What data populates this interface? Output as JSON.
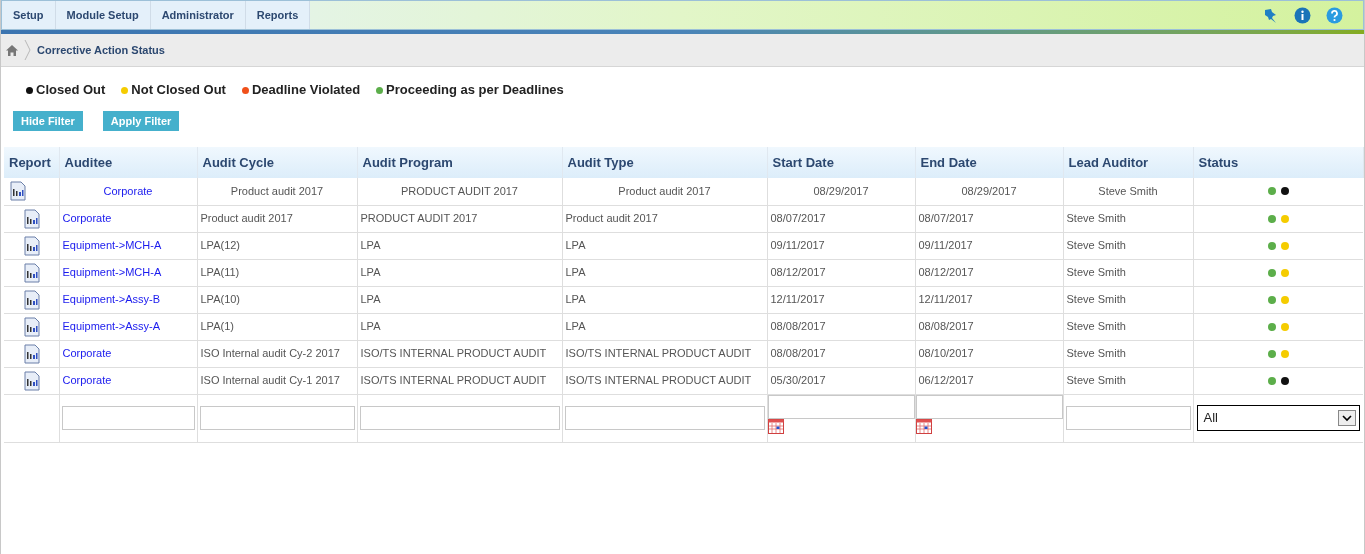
{
  "menu": [
    {
      "label": "Setup",
      "selected": false
    },
    {
      "label": "Module Setup",
      "selected": false
    },
    {
      "label": "Administrator",
      "selected": false
    },
    {
      "label": "Reports",
      "selected": false
    }
  ],
  "breadcrumb": {
    "title": "Corrective Action Status"
  },
  "legend": [
    {
      "label": "Closed Out",
      "color": "#111111"
    },
    {
      "label": "Not Closed Out",
      "color": "#f5cc00"
    },
    {
      "label": "Deadline Violated",
      "color": "#f0501a"
    },
    {
      "label": "Proceeding as per Deadlines",
      "color": "#5cae4a"
    }
  ],
  "buttons": [
    "Hide Filter",
    "Apply Filter"
  ],
  "table": {
    "columns": [
      "Report",
      "Auditee",
      "Audit Cycle",
      "Audit Program",
      "Audit Type",
      "Start Date",
      "End Date",
      "Lead Auditor",
      "Status"
    ],
    "rows": [
      {
        "kind": "centered",
        "auditee": "Corporate",
        "audit_cycle": "Product audit 2017",
        "audit_program": "PRODUCT AUDIT 2017",
        "audit_type": "Product audit 2017",
        "start_date": "08/29/2017",
        "end_date": "08/29/2017",
        "lead_auditor": "Steve Smith",
        "status": [
          {
            "color": "#5cae4a"
          },
          {
            "color": "#111111"
          }
        ]
      },
      {
        "kind": "plain",
        "auditee": "Corporate",
        "audit_cycle": "Product audit 2017",
        "audit_program": "PRODUCT AUDIT 2017",
        "audit_type": "Product audit 2017",
        "start_date": "08/07/2017",
        "end_date": "08/07/2017",
        "lead_auditor": "Steve Smith",
        "status": [
          {
            "color": "#5cae4a"
          },
          {
            "color": "#f5cc00"
          }
        ]
      },
      {
        "kind": "plain",
        "auditee": "Equipment->MCH-A",
        "audit_cycle": "LPA(12)",
        "audit_program": "LPA",
        "audit_type": "LPA",
        "start_date": "09/11/2017",
        "end_date": "09/11/2017",
        "lead_auditor": "Steve Smith",
        "status": [
          {
            "color": "#5cae4a"
          },
          {
            "color": "#f5cc00"
          }
        ]
      },
      {
        "kind": "plain",
        "auditee": "Equipment->MCH-A",
        "audit_cycle": "LPA(11)",
        "audit_program": "LPA",
        "audit_type": "LPA",
        "start_date": "08/12/2017",
        "end_date": "08/12/2017",
        "lead_auditor": "Steve Smith",
        "status": [
          {
            "color": "#5cae4a"
          },
          {
            "color": "#f5cc00"
          }
        ]
      },
      {
        "kind": "plain",
        "auditee": "Equipment->Assy-B",
        "audit_cycle": "LPA(10)",
        "audit_program": "LPA",
        "audit_type": "LPA",
        "start_date": "12/11/2017",
        "end_date": "12/11/2017",
        "lead_auditor": "Steve Smith",
        "status": [
          {
            "color": "#5cae4a"
          },
          {
            "color": "#f5cc00"
          }
        ]
      },
      {
        "kind": "plain",
        "auditee": "Equipment->Assy-A",
        "audit_cycle": "LPA(1)",
        "audit_program": "LPA",
        "audit_type": "LPA",
        "start_date": "08/08/2017",
        "end_date": "08/08/2017",
        "lead_auditor": "Steve Smith",
        "status": [
          {
            "color": "#5cae4a"
          },
          {
            "color": "#f5cc00"
          }
        ]
      },
      {
        "kind": "plain",
        "auditee": "Corporate",
        "audit_cycle": "ISO Internal audit Cy-2 2017",
        "audit_program": "ISO/TS INTERNAL PRODUCT AUDIT",
        "audit_type": "ISO/TS INTERNAL PRODUCT AUDIT",
        "start_date": "08/08/2017",
        "end_date": "08/10/2017",
        "lead_auditor": "Steve Smith",
        "status": [
          {
            "color": "#5cae4a"
          },
          {
            "color": "#f5cc00"
          }
        ]
      },
      {
        "kind": "plain",
        "auditee": "Corporate",
        "audit_cycle": "ISO Internal audit Cy-1 2017",
        "audit_program": "ISO/TS INTERNAL PRODUCT AUDIT",
        "audit_type": "ISO/TS INTERNAL PRODUCT AUDIT",
        "start_date": "05/30/2017",
        "end_date": "06/12/2017",
        "lead_auditor": "Steve Smith",
        "status": [
          {
            "color": "#5cae4a"
          },
          {
            "color": "#111111"
          }
        ]
      }
    ],
    "filters": [
      {
        "kind": "none"
      },
      {
        "kind": "text"
      },
      {
        "kind": "text"
      },
      {
        "kind": "text"
      },
      {
        "kind": "text"
      },
      {
        "kind": "date"
      },
      {
        "kind": "date"
      },
      {
        "kind": "text"
      },
      {
        "kind": "select",
        "value": "All"
      }
    ]
  }
}
